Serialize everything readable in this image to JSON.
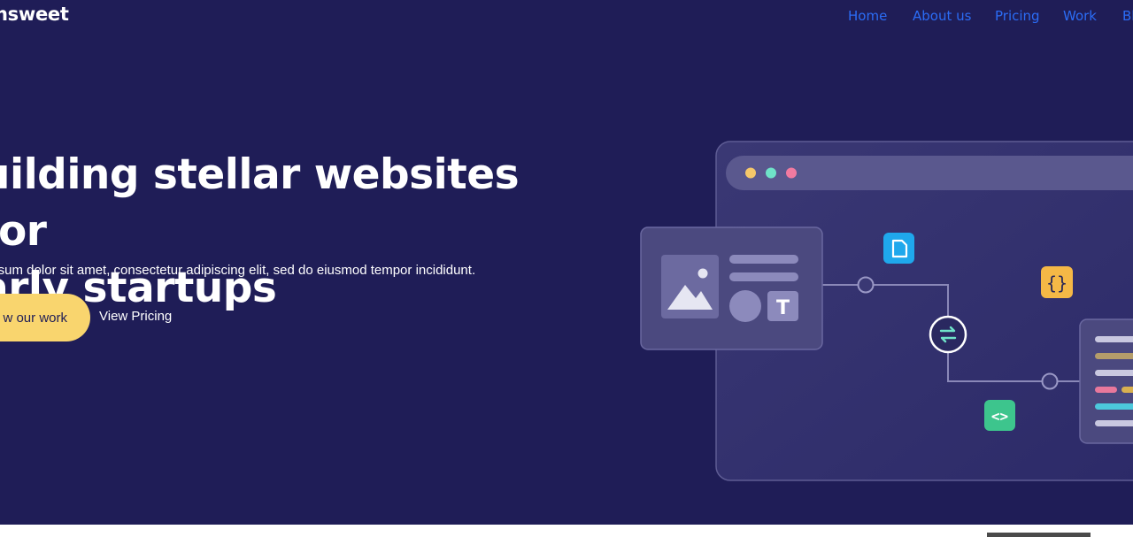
{
  "brand": {
    "logo_text": "nsweet"
  },
  "nav": {
    "items": [
      {
        "label": "Home"
      },
      {
        "label": "About us"
      },
      {
        "label": "Pricing"
      },
      {
        "label": "Work"
      },
      {
        "label": "Bl"
      }
    ]
  },
  "hero": {
    "headline_line1": "uilding stellar websites for",
    "headline_line2": "arly startups",
    "subtitle": "ipsum dolor sit amet, consectetur adipiscing elit, sed do eiusmod tempor incididunt.",
    "primary_cta": "w our work",
    "secondary_cta": "View Pricing"
  },
  "colors": {
    "background": "#1f1d57",
    "nav_link": "#2b6cf5",
    "primary_button": "#f9d56e",
    "dot_yellow": "#f6c86a",
    "dot_teal": "#6fe3c8",
    "dot_pink": "#f27aa0",
    "file_icon_bg": "#1fa8ec",
    "braces_icon_bg": "#f5b846",
    "code_icon_bg": "#3dc58d"
  },
  "illustration": {
    "icons": [
      "image-icon",
      "text-t-icon",
      "file-icon",
      "braces-icon",
      "sync-icon",
      "code-icon"
    ],
    "text_icon_glyph": "T",
    "braces_glyph": "{}",
    "code_glyph": "<>"
  }
}
